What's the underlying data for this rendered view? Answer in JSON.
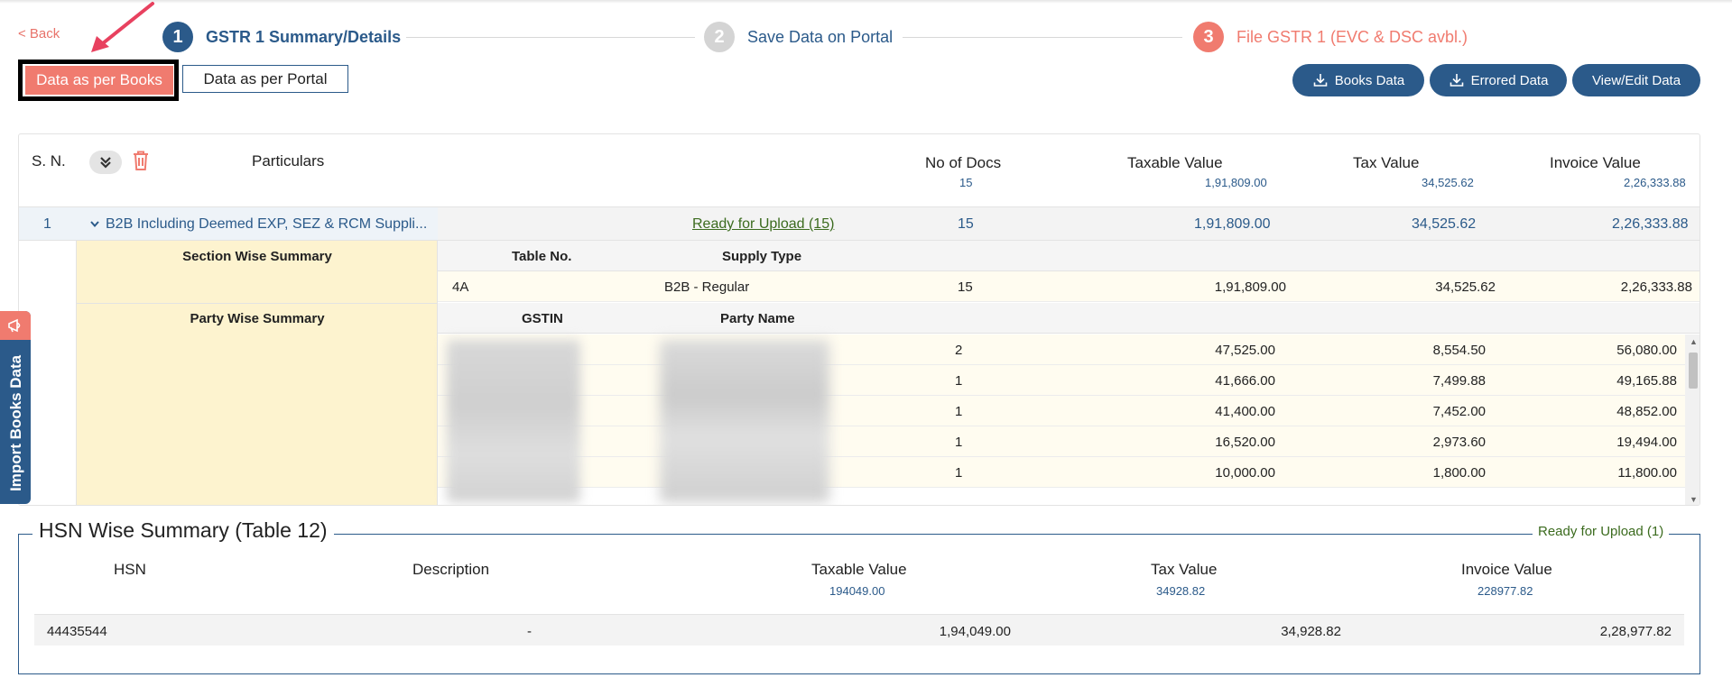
{
  "nav": {
    "back_label": "< Back"
  },
  "stepper": [
    {
      "number": "1",
      "label": "GSTR 1 Summary/Details"
    },
    {
      "number": "2",
      "label": "Save Data on Portal"
    },
    {
      "number": "3",
      "label": "File GSTR 1 (EVC & DSC avbl.)"
    }
  ],
  "mode_toggle": {
    "books_label": "Data as per Books",
    "portal_label": "Data as per Portal",
    "active": "books"
  },
  "actions": {
    "books_data": "Books Data",
    "errored_data": "Errored Data",
    "view_edit": "View/Edit Data"
  },
  "summary_table": {
    "headers": {
      "sn": "S. N.",
      "particulars": "Particulars",
      "no_of_docs": "No of Docs",
      "taxable_value": "Taxable Value",
      "tax_value": "Tax Value",
      "invoice_value": "Invoice Value"
    },
    "totals": {
      "no_of_docs": "15",
      "taxable_value": "1,91,809.00",
      "tax_value": "34,525.62",
      "invoice_value": "2,26,333.88"
    },
    "b2b_row": {
      "sn": "1",
      "particulars": "B2B Including Deemed EXP, SEZ & RCM Suppli...",
      "status": "Ready for Upload (15)",
      "no_of_docs": "15",
      "taxable_value": "1,91,809.00",
      "tax_value": "34,525.62",
      "invoice_value": "2,26,333.88"
    },
    "section_wise": {
      "title": "Section Wise Summary",
      "headers": {
        "table_no": "Table No.",
        "supply_type": "Supply Type"
      },
      "rows": [
        {
          "table_no": "4A",
          "supply_type": "B2B - Regular",
          "docs": "15",
          "taxable": "1,91,809.00",
          "tax": "34,525.62",
          "invoice": "2,26,333.88"
        }
      ]
    },
    "party_wise": {
      "title": "Party Wise Summary",
      "headers": {
        "gstin": "GSTIN",
        "party_name": "Party Name"
      },
      "rows": [
        {
          "docs": "2",
          "taxable": "47,525.00",
          "tax": "8,554.50",
          "invoice": "56,080.00"
        },
        {
          "docs": "1",
          "taxable": "41,666.00",
          "tax": "7,499.88",
          "invoice": "49,165.88"
        },
        {
          "docs": "1",
          "taxable": "41,400.00",
          "tax": "7,452.00",
          "invoice": "48,852.00"
        },
        {
          "docs": "1",
          "taxable": "16,520.00",
          "tax": "2,973.60",
          "invoice": "19,494.00"
        },
        {
          "docs": "1",
          "taxable": "10,000.00",
          "tax": "1,800.00",
          "invoice": "11,800.00"
        }
      ]
    }
  },
  "side_tab": {
    "label": "Import Books Data"
  },
  "hsn": {
    "title": "HSN Wise Summary (Table 12)",
    "status": "Ready for Upload (1)",
    "headers": {
      "hsn": "HSN",
      "description": "Description",
      "taxable_value": "Taxable Value",
      "tax_value": "Tax Value",
      "invoice_value": "Invoice Value"
    },
    "totals": {
      "taxable_value": "194049.00",
      "tax_value": "34928.82",
      "invoice_value": "228977.82"
    },
    "rows": [
      {
        "hsn": "44435544",
        "description": "-",
        "taxable": "1,94,049.00",
        "tax": "34,928.82",
        "invoice": "2,28,977.82"
      }
    ]
  },
  "colors": {
    "primary": "#2b5a8a",
    "accent": "#f07b6f",
    "success": "#3b6b1e",
    "highlight_row": "#fdf3cf"
  }
}
